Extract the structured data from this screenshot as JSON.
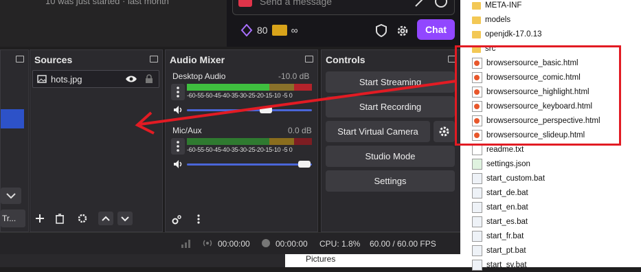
{
  "chat": {
    "faded_message": "10 was just started · last month",
    "placeholder": "Send a message",
    "points": "80",
    "ticket": "∞",
    "chat_button": "Chat"
  },
  "docks": {
    "sources": {
      "title": "Sources",
      "items": [
        {
          "name": "hots.jpg"
        }
      ]
    },
    "left_stub": {
      "truncated_label": "Tr..."
    },
    "mixer": {
      "title": "Audio Mixer",
      "channels": [
        {
          "name": "Desktop Audio",
          "level": "-10.0 dB",
          "volume_fraction": 0.6
        },
        {
          "name": "Mic/Aux",
          "level": "0.0 dB",
          "volume_fraction": 1.0
        }
      ],
      "ticks": "-60-55-50-45-40-35-30-25-20-15-10 -5  0"
    },
    "controls": {
      "title": "Controls",
      "buttons": [
        "Start Streaming",
        "Start Recording",
        "Start Virtual Camera",
        "Studio Mode",
        "Settings"
      ]
    }
  },
  "statusbar": {
    "stream_time": "00:00:00",
    "rec_time": "00:00:00",
    "cpu": "CPU: 1.8%",
    "fps": "60.00 / 60.00 FPS"
  },
  "explorer": {
    "files": [
      {
        "name": "META-INF",
        "type": "folder"
      },
      {
        "name": "models",
        "type": "folder"
      },
      {
        "name": "openjdk-17.0.13",
        "type": "folder"
      },
      {
        "name": "src",
        "type": "folder"
      },
      {
        "name": "browsersource_basic.html",
        "type": "html"
      },
      {
        "name": "browsersource_comic.html",
        "type": "html"
      },
      {
        "name": "browsersource_highlight.html",
        "type": "html"
      },
      {
        "name": "browsersource_keyboard.html",
        "type": "html"
      },
      {
        "name": "browsersource_perspective.html",
        "type": "html"
      },
      {
        "name": "browsersource_slideup.html",
        "type": "html"
      },
      {
        "name": "readme.txt",
        "type": "txt"
      },
      {
        "name": "settings.json",
        "type": "json"
      },
      {
        "name": "start_custom.bat",
        "type": "bat"
      },
      {
        "name": "start_de.bat",
        "type": "bat"
      },
      {
        "name": "start_en.bat",
        "type": "bat"
      },
      {
        "name": "start_es.bat",
        "type": "bat"
      },
      {
        "name": "start_fr.bat",
        "type": "bat"
      },
      {
        "name": "start_pt.bat",
        "type": "bat"
      },
      {
        "name": "start_sv.bat",
        "type": "bat"
      }
    ],
    "nav_label": "Pictures"
  },
  "colors": {
    "accent": "#9147ff",
    "annotation": "#e21b23",
    "meter_green": "#3fbf3f",
    "meter_yellow": "#c8a228",
    "meter_red": "#b3232b",
    "slider_blue": "#4a66d9"
  }
}
